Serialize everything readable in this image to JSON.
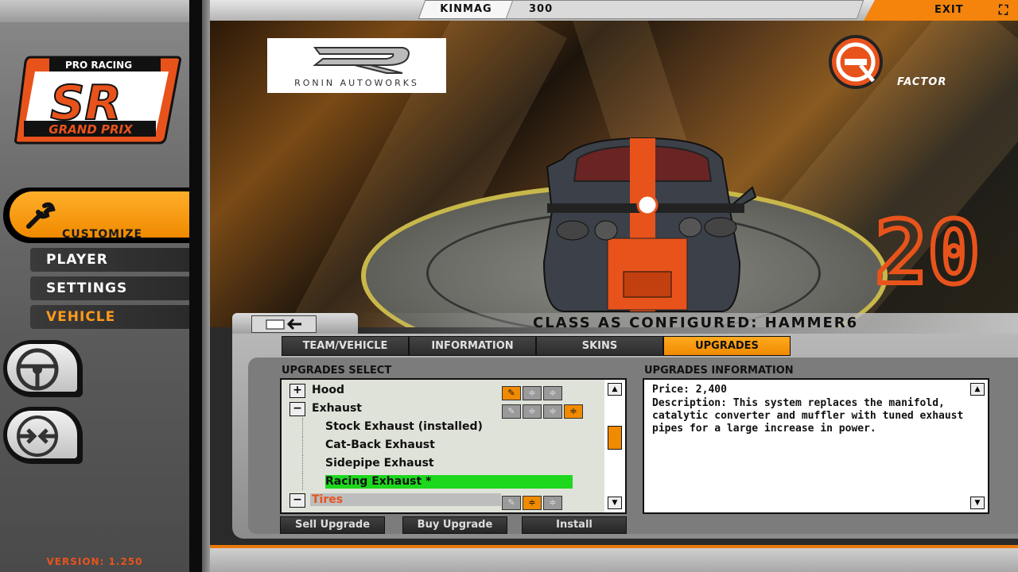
{
  "topbar": {
    "car_make": "KINMAG",
    "car_number": "300",
    "exit_label": "EXIT",
    "exit_icon": "close-x-icon"
  },
  "sidebar": {
    "logo": {
      "line1": "PRO RACING",
      "line2": "SR",
      "line3": "GRAND PRIX"
    },
    "customize_label": "CUSTOMIZE",
    "menu": [
      {
        "label": "PLAYER"
      },
      {
        "label": "SETTINGS"
      },
      {
        "label": "VEHICLE"
      }
    ],
    "version": "VERSION: 1.250"
  },
  "scene": {
    "sponsor_left": "RONIN AUTOWORKS",
    "sponsor_right": "FACTOR",
    "car_number_big": "20"
  },
  "class_bar": {
    "label": "CLASS AS CONFIGURED: HAMMER6"
  },
  "tabs": [
    {
      "label": "TEAM/VEHICLE"
    },
    {
      "label": "INFORMATION"
    },
    {
      "label": "SKINS"
    },
    {
      "label": "UPGRADES"
    }
  ],
  "upgrades_select": {
    "title": "UPGRADES SELECT",
    "hood": "Hood",
    "exhaust": "Exhaust",
    "options": [
      "Stock Exhaust (installed)",
      "Cat-Back Exhaust",
      "Sidepipe Exhaust",
      "Racing Exhaust *"
    ],
    "tires": "Tires"
  },
  "upgrades_info": {
    "title": "UPGRADES INFORMATION",
    "price": "Price: 2,400",
    "description": "Description: This system replaces the manifold, catalytic converter and muffler with tuned exhaust pipes for a large increase in power."
  },
  "buttons": {
    "sell": "Sell Upgrade",
    "buy": "Buy Upgrade",
    "install": "Install"
  },
  "colors": {
    "accent": "#f08a00",
    "highlight": "#1ed81e",
    "version_text": "#e8531c"
  }
}
